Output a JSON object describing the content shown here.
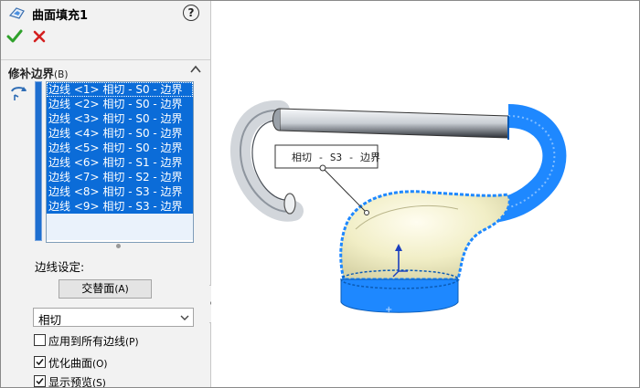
{
  "header": {
    "title": "曲面填充1",
    "help_glyph": "?"
  },
  "actions": {
    "ok": "confirm-check",
    "cancel": "cancel-x"
  },
  "section": {
    "title": "修补边界",
    "shortcut": "(B)"
  },
  "edges": [
    "边线 <1> 相切 - S0 - 边界",
    "边线 <2> 相切 - S0 - 边界",
    "边线 <3> 相切 - S0 - 边界",
    "边线 <4> 相切 - S0 - 边界",
    "边线 <5> 相切 - S0 - 边界",
    "边线 <6> 相切 - S1 - 边界",
    "边线 <7> 相切 - S2 - 边界",
    "边线 <8> 相切 - S3 - 边界",
    "边线 <9> 相切 - S3 - 边界"
  ],
  "edge_settings": {
    "label": "边线设定:",
    "alternate_face_button": "交替面",
    "alternate_face_shortcut": "(A)",
    "continuity_value": "相切"
  },
  "options": [
    {
      "label": "应用到所有边线",
      "shortcut": "(P)",
      "checked": false
    },
    {
      "label": "优化曲面",
      "shortcut": "(O)",
      "checked": true
    },
    {
      "label": "显示预览",
      "shortcut": "(S)",
      "checked": true
    }
  ],
  "viewport": {
    "callout": "相切 - S3 - 边界",
    "colors": {
      "selection_blue": "#1e88ff",
      "patch_yellow": "#f3f0c8",
      "tube_gray": "#cfd3d8"
    }
  }
}
